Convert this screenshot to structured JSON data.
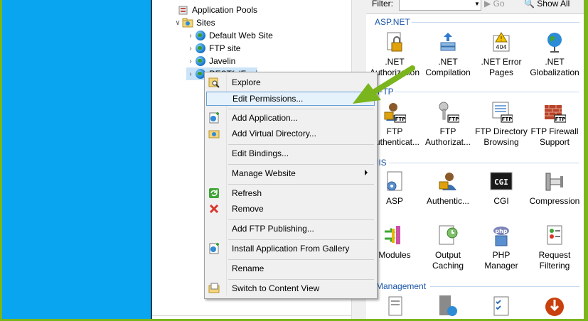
{
  "tree": {
    "application_pools": "Application Pools",
    "sites": "Sites",
    "site_items": [
      "Default Web Site",
      "FTP site",
      "Javelin",
      "RESTfulFapi"
    ]
  },
  "filter": {
    "label": "Filter:",
    "go": "Go",
    "show_all": "Show All"
  },
  "sections": {
    "aspnet": "ASP.NET",
    "ftp": "FTP",
    "iis": "IIS",
    "management": "Management"
  },
  "features": {
    "aspnet": [
      {
        "l1": ".NET",
        "l2": "Authorization"
      },
      {
        "l1": ".NET",
        "l2": "Compilation"
      },
      {
        "l1": ".NET Error",
        "l2": "Pages"
      },
      {
        "l1": ".NET",
        "l2": "Globalization"
      }
    ],
    "ftp": [
      {
        "l1": "FTP",
        "l2": "Authenticat..."
      },
      {
        "l1": "FTP",
        "l2": "Authorizat..."
      },
      {
        "l1": "FTP Directory",
        "l2": "Browsing"
      },
      {
        "l1": "FTP Firewall",
        "l2": "Support"
      }
    ],
    "iis1": [
      {
        "l1": "ASP",
        "l2": ""
      },
      {
        "l1": "Authentic...",
        "l2": ""
      },
      {
        "l1": "CGI",
        "l2": ""
      },
      {
        "l1": "Compression",
        "l2": ""
      }
    ],
    "iis2": [
      {
        "l1": "Modules",
        "l2": ""
      },
      {
        "l1": "Output",
        "l2": "Caching"
      },
      {
        "l1": "PHP",
        "l2": "Manager"
      },
      {
        "l1": "Request",
        "l2": "Filtering"
      }
    ]
  },
  "icon_text": {
    "cgi": "CGI",
    "ftp": "FTP",
    "php": "php",
    "err": "404"
  },
  "context_menu": {
    "explore": "Explore",
    "edit_permissions": "Edit Permissions...",
    "add_application": "Add Application...",
    "add_virtual_directory": "Add Virtual Directory...",
    "edit_bindings": "Edit Bindings...",
    "manage_website": "Manage Website",
    "refresh": "Refresh",
    "remove": "Remove",
    "add_ftp_publishing": "Add FTP Publishing...",
    "install_from_gallery": "Install Application From Gallery",
    "rename": "Rename",
    "switch_content_view": "Switch to Content View"
  },
  "colors": {
    "frame_green": "#7bb51b",
    "left_blue": "#0aa5f0",
    "section_blue": "#1a56a8",
    "arrow_green": "#7ab51d"
  }
}
